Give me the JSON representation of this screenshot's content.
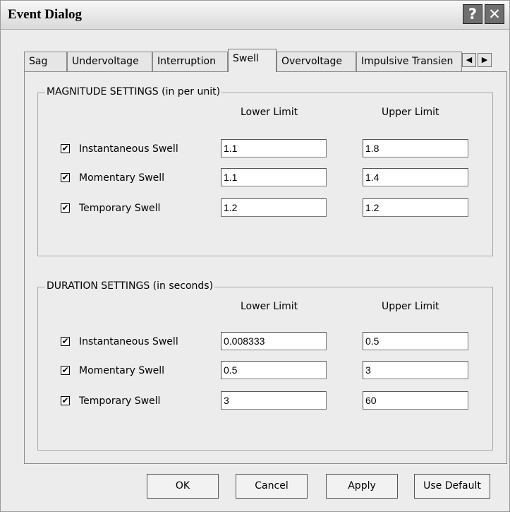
{
  "window": {
    "title": "Event Dialog",
    "help_glyph": "?",
    "close_glyph": "✕"
  },
  "tabs": [
    {
      "label": "Sag"
    },
    {
      "label": "Undervoltage"
    },
    {
      "label": "Interruption"
    },
    {
      "label": "Swell",
      "active": true
    },
    {
      "label": "Overvoltage"
    },
    {
      "label": "Impulsive Transien"
    }
  ],
  "tab_scroll": {
    "left_glyph": "◀",
    "right_glyph": "▶"
  },
  "magnitude": {
    "title": "MAGNITUDE SETTINGS (in per unit)",
    "lower_header": "Lower Limit",
    "upper_header": "Upper Limit",
    "rows": [
      {
        "label": "Instantaneous Swell",
        "checked": true,
        "lower": "1.1",
        "upper": "1.8"
      },
      {
        "label": "Momentary Swell",
        "checked": true,
        "lower": "1.1",
        "upper": "1.4"
      },
      {
        "label": "Temporary Swell",
        "checked": true,
        "lower": "1.2",
        "upper": "1.2"
      }
    ]
  },
  "duration": {
    "title": "DURATION SETTINGS (in seconds)",
    "lower_header": "Lower Limit",
    "upper_header": "Upper Limit",
    "rows": [
      {
        "label": "Instantaneous Swell",
        "checked": true,
        "lower": "0.008333",
        "upper": "0.5"
      },
      {
        "label": "Momentary Swell",
        "checked": true,
        "lower": "0.5",
        "upper": "3"
      },
      {
        "label": "Temporary Swell",
        "checked": true,
        "lower": "3",
        "upper": "60"
      }
    ]
  },
  "checkmark": "✔",
  "buttons": {
    "ok": "OK",
    "cancel": "Cancel",
    "apply": "Apply",
    "use_default": "Use Default"
  }
}
